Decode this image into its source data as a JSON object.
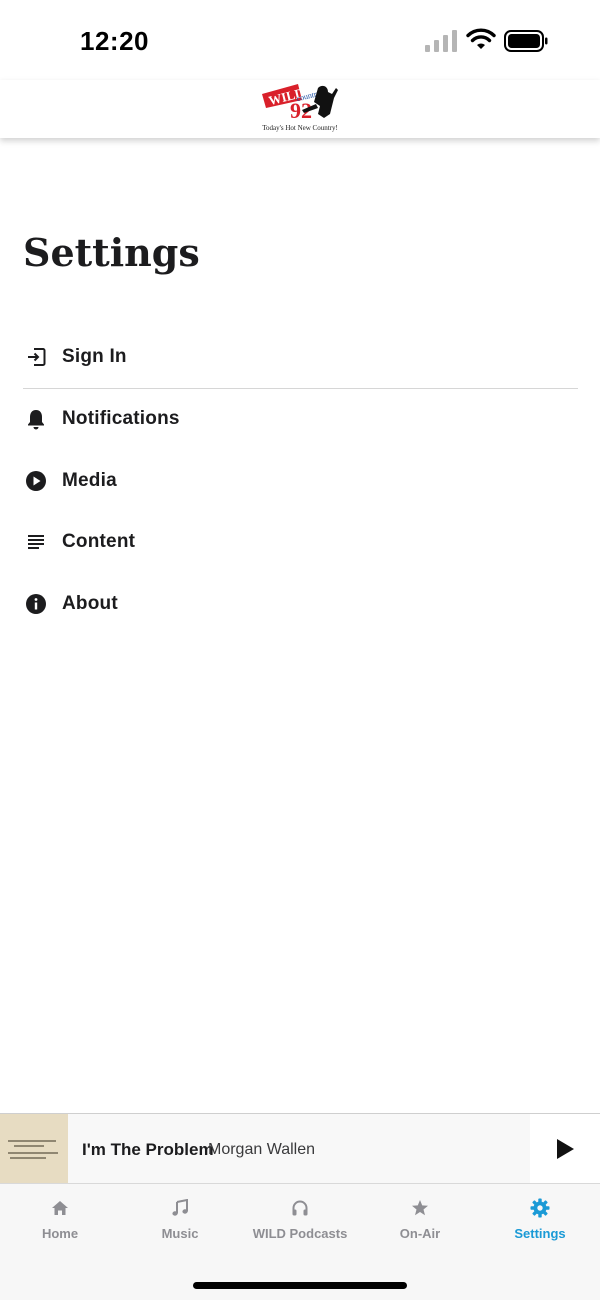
{
  "status_bar": {
    "time": "12:20",
    "icons": [
      "cellular-signal-icon",
      "wifi-icon",
      "battery-icon"
    ]
  },
  "header": {
    "logo_text": "WILD country 92",
    "logo_tagline": "Today's Hot New Country!"
  },
  "page": {
    "title": "Settings"
  },
  "settings": {
    "items": [
      {
        "label": "Sign In",
        "icon": "sign-in-icon"
      },
      {
        "label": "Notifications",
        "icon": "bell-icon"
      },
      {
        "label": "Media",
        "icon": "play-circle-icon"
      },
      {
        "label": "Content",
        "icon": "lines-icon"
      },
      {
        "label": "About",
        "icon": "info-icon"
      }
    ]
  },
  "now_playing": {
    "title": "I'm The Problem",
    "artist": "Morgan Wallen",
    "play_icon": "play-icon"
  },
  "tab_bar": {
    "active": "Settings",
    "accent_color": "#1a9ad6",
    "tabs": [
      {
        "label": "Home",
        "icon": "home-icon"
      },
      {
        "label": "Music",
        "icon": "music-note-icon"
      },
      {
        "label": "WILD Podcasts",
        "icon": "headphones-icon"
      },
      {
        "label": "On-Air",
        "icon": "star-icon"
      },
      {
        "label": "Settings",
        "icon": "gear-icon"
      }
    ]
  }
}
